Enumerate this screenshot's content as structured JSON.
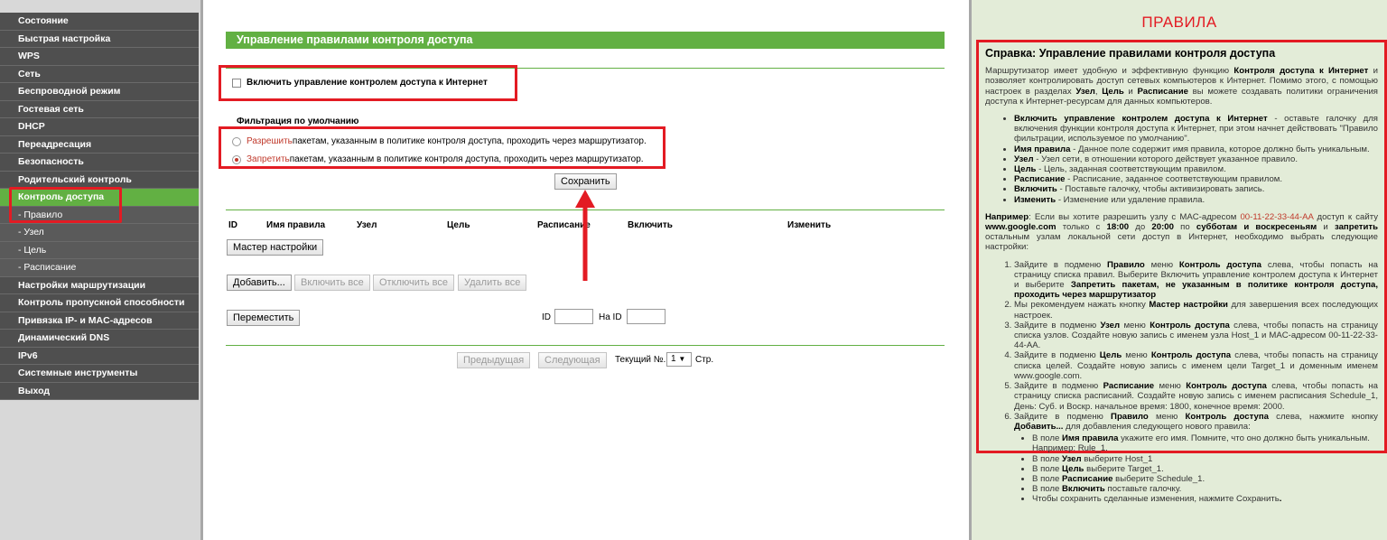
{
  "sidebar": {
    "items": [
      {
        "label": "Состояние"
      },
      {
        "label": "Быстрая настройка"
      },
      {
        "label": "WPS"
      },
      {
        "label": "Сеть"
      },
      {
        "label": "Беспроводной режим"
      },
      {
        "label": "Гостевая сеть"
      },
      {
        "label": "DHCP"
      },
      {
        "label": "Переадресация"
      },
      {
        "label": "Безопасность"
      },
      {
        "label": "Родительский контроль"
      },
      {
        "label": "Контроль доступа"
      },
      {
        "label": "- Правило"
      },
      {
        "label": "- Узел"
      },
      {
        "label": "- Цель"
      },
      {
        "label": "- Расписание"
      },
      {
        "label": "Настройки маршрутизации"
      },
      {
        "label": "Контроль пропускной способности"
      },
      {
        "label": "Привязка IP- и MAC-адресов"
      },
      {
        "label": "Динамический DNS"
      },
      {
        "label": "IPv6"
      },
      {
        "label": "Системные инструменты"
      },
      {
        "label": "Выход"
      }
    ]
  },
  "main": {
    "title": "Управление правилами контроля доступа",
    "enable_label": "Включить управление контролем доступа к Интернет",
    "filter_title": "Фильтрация по умолчанию",
    "allow_word": "Разрешить",
    "allow_rest": " пакетам, указанным в политике контроля доступа, проходить через маршрутизатор.",
    "deny_word": "Запретить",
    "deny_rest": " пакетам, указанным в политике контроля доступа, проходить через маршрутизатор.",
    "save_label": "Сохранить",
    "columns": [
      "ID",
      "Имя правила",
      "Узел",
      "Цель",
      "Расписание",
      "Включить",
      "Изменить"
    ],
    "wizard_label": "Мастер настройки",
    "add_label": "Добавить...",
    "enable_all_label": "Включить все",
    "disable_all_label": "Отключить все",
    "delete_all_label": "Удалить все",
    "move_label": "Переместить",
    "id_label": "ID",
    "to_id_label": "На ID",
    "prev_label": "Предыдущая",
    "next_label": "Следующая",
    "current_label": "Текущий №.",
    "current_page": "1",
    "page_suffix": "Стр."
  },
  "help": {
    "panel_label": "ПРАВИЛА",
    "title": "Справка: Управление правилами контроля доступа",
    "intro_1": "Маршрутизатор имеет удобную и эффективную функцию ",
    "intro_b1": "Контроля доступа к Интернет",
    "intro_2": " и позволяет контролировать доступ сетевых компьютеров к Интернет. Помимо этого, с помощью настроек в разделах ",
    "intro_b2": "Узел",
    "intro_3": ", ",
    "intro_b3": "Цель",
    "intro_4": " и ",
    "intro_b4": "Расписание",
    "intro_5": " вы можете создавать политики ограничения доступа к Интернет-ресурсам для данных компьютеров.",
    "bullets": [
      {
        "b": "Включить управление контролем доступа к Интернет",
        "t": " - оставьте галочку для включения функции контроля доступа к Интернет, при этом начнет действовать \"Правило фильтрации, используемое по умолчанию\"."
      },
      {
        "b": "Имя правила",
        "t": " - Данное поле содержит имя правила, которое должно быть уникальным."
      },
      {
        "b": "Узел",
        "t": " - Узел сети, в отношении которого действует указанное правило."
      },
      {
        "b": "Цель",
        "t": " - Цель, заданная соответствующим правилом."
      },
      {
        "b": "Расписание",
        "t": " - Расписание, заданное соответствующим правилом."
      },
      {
        "b": "Включить",
        "t": " - Поставьте галочку, чтобы активизировать запись."
      },
      {
        "b": "Изменить",
        "t": " - Изменение или удаление правила."
      }
    ],
    "ex_b1": "Например",
    "ex_1": ": Если вы хотите разрешить узлу с MAC-адресом ",
    "ex_mac": "00-11-22-33-44-AA",
    "ex_2": " доступ к сайту ",
    "ex_b2": "www.google.com",
    "ex_3": " только с ",
    "ex_b3": "18:00",
    "ex_4": " до ",
    "ex_b4": "20:00",
    "ex_5": " по ",
    "ex_b5": "субботам и воскресеньям",
    "ex_6": " и ",
    "ex_b6": "запретить",
    "ex_7": " остальным узлам локальной сети доступ в Интернет, необходимо выбрать следующие настройки:",
    "steps": [
      {
        "p": [
          [
            "",
            "Зайдите в подменю "
          ],
          [
            "b",
            "Правило"
          ],
          [
            "",
            " меню "
          ],
          [
            "b",
            "Контроль доступа"
          ],
          [
            "",
            " слева, чтобы попасть на страницу списка правил. Выберите Включить управление контролем доступа к Интернет и выберите "
          ],
          [
            "b",
            "Запретить пакетам, не указанным в политике контроля доступа, проходить через маршрутизатор"
          ]
        ]
      },
      {
        "p": [
          [
            "",
            "Мы рекомендуем нажать кнопку "
          ],
          [
            "b",
            "Мастер настройки"
          ],
          [
            "",
            " для завершения всех последующих настроек."
          ]
        ]
      },
      {
        "p": [
          [
            "",
            "Зайдите в подменю "
          ],
          [
            "b",
            "Узел"
          ],
          [
            "",
            " меню "
          ],
          [
            "b",
            "Контроль доступа"
          ],
          [
            "",
            " слева, чтобы попасть на страницу списка узлов. Создайте новую запись с именем узла Host_1 и MAC-адресом 00-11-22-33-44-AA."
          ]
        ]
      },
      {
        "p": [
          [
            "",
            "Зайдите в подменю "
          ],
          [
            "b",
            "Цель"
          ],
          [
            "",
            " меню "
          ],
          [
            "b",
            "Контроль доступа"
          ],
          [
            "",
            " слева, чтобы попасть на страницу списка целей. Создайте новую запись с именем цели Target_1 и доменным именем www.google.com."
          ]
        ]
      },
      {
        "p": [
          [
            "",
            "Зайдите в подменю "
          ],
          [
            "b",
            "Расписание"
          ],
          [
            "",
            " меню "
          ],
          [
            "b",
            "Контроль доступа"
          ],
          [
            "",
            " слева, чтобы попасть на страницу списка расписаний. Создайте новую запись с именем расписания Schedule_1, День: Суб. и Воскр. начальное время: 1800, конечное время: 2000."
          ]
        ]
      },
      {
        "p": [
          [
            "",
            "Зайдите в подменю "
          ],
          [
            "b",
            "Правило"
          ],
          [
            "",
            " меню "
          ],
          [
            "b",
            "Контроль доступа"
          ],
          [
            "",
            " слева, нажмите кнопку "
          ],
          [
            "b",
            "Добавить..."
          ],
          [
            "",
            " для добавления следующего нового правила:"
          ]
        ]
      }
    ],
    "substeps": [
      {
        "p": [
          [
            "",
            "В поле "
          ],
          [
            "b",
            "Имя правила"
          ],
          [
            "",
            " укажите его имя. Помните, что оно должно быть уникальным. Например: Rule_1."
          ]
        ]
      },
      {
        "p": [
          [
            "",
            "В поле "
          ],
          [
            "b",
            "Узел"
          ],
          [
            "",
            " выберите Host_1"
          ]
        ]
      },
      {
        "p": [
          [
            "",
            "В поле "
          ],
          [
            "b",
            "Цель"
          ],
          [
            "",
            " выберите Target_1."
          ]
        ]
      },
      {
        "p": [
          [
            "",
            "В поле "
          ],
          [
            "b",
            "Расписание"
          ],
          [
            "",
            " выберите Schedule_1."
          ]
        ]
      },
      {
        "p": [
          [
            "",
            "В поле "
          ],
          [
            "b",
            "Включить"
          ],
          [
            "",
            " поставьте галочку."
          ]
        ]
      },
      {
        "p": [
          [
            "",
            "Чтобы сохранить сделанные изменения, нажмите Сохранить"
          ],
          [
            "b",
            "."
          ]
        ]
      }
    ]
  },
  "colors": {
    "accent_green": "#62b043",
    "annotation_red": "#e31b23",
    "sidebar_dark": "#4f4f4f",
    "help_bg": "#e3ecd8"
  }
}
